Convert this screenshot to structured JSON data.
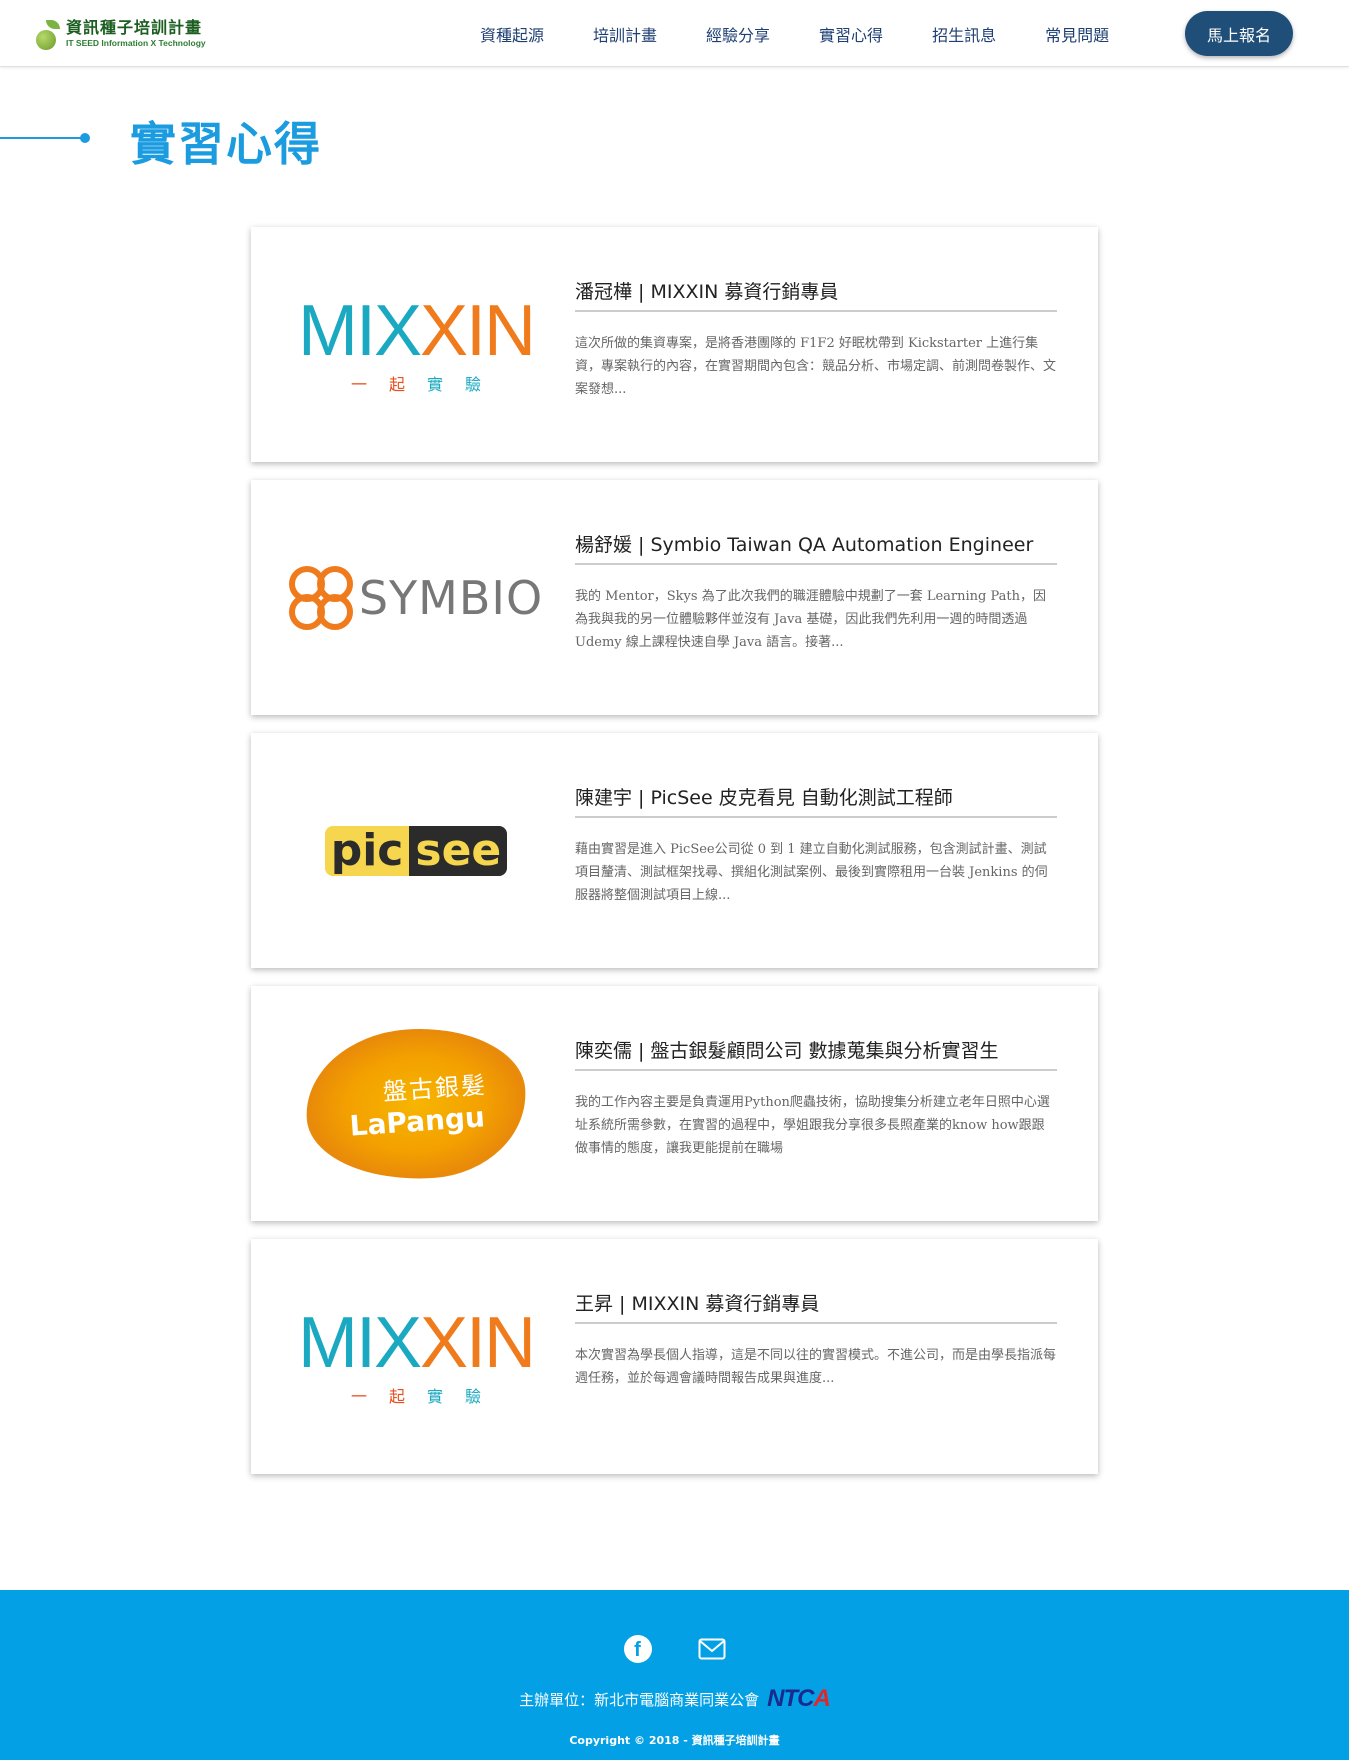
{
  "header": {
    "logo_cn": "資訊種子培訓計畫",
    "logo_en": "IT SEED  Information X Technology",
    "nav": [
      "資種起源",
      "培訓計畫",
      "經驗分享",
      "實習心得",
      "招生訊息",
      "常見問題"
    ],
    "signup_label": "馬上報名"
  },
  "page": {
    "title": "實習心得"
  },
  "posts": [
    {
      "name": "潘冠樺 | MIXXIN 募資行銷專員",
      "excerpt": "這次所做的集資專案，是將香港團隊的 F1F2 好眠枕帶到 Kickstarter 上進行集資，專案執行的內容，在實習期間內包含：競品分析、市場定調、前測問卷製作、文案發想...",
      "logo": {
        "word_a": "MIX",
        "word_b": "XIN",
        "sub_a": "一起",
        "sub_b": "實驗"
      }
    },
    {
      "name": "楊舒媛 | Symbio Taiwan QA Automation Engineer",
      "excerpt": "我的 Mentor，Skys 為了此次我們的職涯體驗中規劃了一套 Learning Path，因為我與我的另一位體驗夥伴並沒有 Java 基礎，因此我們先利用一週的時間透過 Udemy 線上課程快速自學 Java 語言。接著...",
      "logo": {
        "word": "SYMBIO"
      }
    },
    {
      "name": "陳建宇 | PicSee 皮克看見 自動化測試工程師",
      "excerpt": "藉由實習是進入 PicSee公司從 0 到 1 建立自動化測試服務，包含測試計畫、測試項目釐清、測試框架找尋、撰組化測試案例、最後到實際租用一台裝 Jenkins 的伺服器將整個測試項目上線...",
      "logo": {
        "word_a": "pic",
        "word_b": "see"
      }
    },
    {
      "name": "陳奕儒 | 盤古銀髮顧問公司 數據蒐集與分析實習生",
      "excerpt": "我的工作內容主要是負責運用Python爬蟲技術，協助搜集分析建立老年日照中心選址系統所需參數，在實習的過程中，學姐跟我分享很多長照產業的know how跟跟做事情的態度，讓我更能提前在職場",
      "logo": {
        "cn": "盤古銀髮",
        "en": "LaPangu"
      }
    },
    {
      "name": "王昇 | MIXXIN 募資行銷專員",
      "excerpt": "本次實習為學長個人指導，這是不同以往的實習模式。不進公司，而是由學長指派每週任務，並於每週會議時間報告成果與進度...",
      "logo": {
        "word_a": "MIX",
        "word_b": "XIN",
        "sub_a": "一起",
        "sub_b": "實驗"
      }
    }
  ],
  "footer": {
    "icons": [
      "facebook-icon",
      "mail-icon"
    ],
    "sponsor_label": "主辦單位：新北市電腦商業同業公會",
    "sponsor_logo_a": "NTC",
    "sponsor_logo_b": "A",
    "copyright": "Copyright © 2018 - 資訊種子培訓計畫"
  },
  "colors": {
    "accent": "#1b9ce0",
    "nav_text": "#1f3f73",
    "button": "#1f4e79",
    "footer_bg": "#03a0e6"
  }
}
